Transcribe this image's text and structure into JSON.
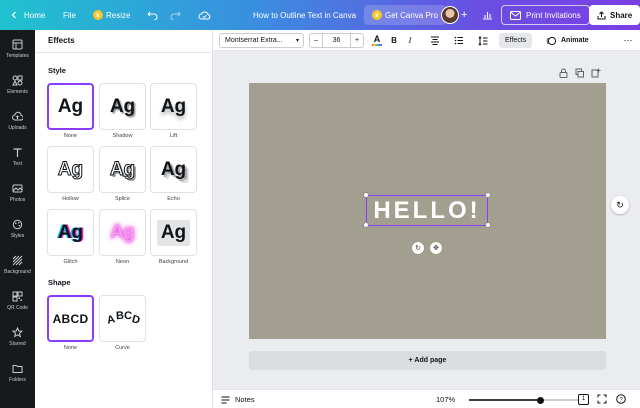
{
  "topbar": {
    "home": "Home",
    "file": "File",
    "resize": "Resize",
    "doc_title": "How to Outline Text in Canva",
    "get_pro": "Get Canva Pro",
    "print": "Print Invitations",
    "share": "Share"
  },
  "rail": {
    "items": [
      {
        "label": "Templates",
        "icon": "templates-icon"
      },
      {
        "label": "Elements",
        "icon": "elements-icon"
      },
      {
        "label": "Uploads",
        "icon": "uploads-icon"
      },
      {
        "label": "Text",
        "icon": "text-icon"
      },
      {
        "label": "Photos",
        "icon": "photos-icon"
      },
      {
        "label": "Styles",
        "icon": "styles-icon"
      },
      {
        "label": "Background",
        "icon": "background-icon"
      },
      {
        "label": "QR Code",
        "icon": "qr-code-icon"
      },
      {
        "label": "Starred",
        "icon": "star-icon"
      },
      {
        "label": "Folders",
        "icon": "folder-icon"
      }
    ]
  },
  "panel": {
    "title": "Effects",
    "style_heading": "Style",
    "shape_heading": "Shape",
    "sample": "Ag",
    "shape_sample": "ABCD",
    "styles": [
      {
        "label": "None",
        "selected": true
      },
      {
        "label": "Shadow",
        "selected": false
      },
      {
        "label": "Lift",
        "selected": false
      },
      {
        "label": "Hollow",
        "selected": false
      },
      {
        "label": "Splice",
        "selected": false
      },
      {
        "label": "Echo",
        "selected": false
      },
      {
        "label": "Glitch",
        "selected": false
      },
      {
        "label": "Neon",
        "selected": false
      },
      {
        "label": "Background",
        "selected": false
      }
    ],
    "shapes": [
      {
        "label": "None",
        "selected": true
      },
      {
        "label": "Curve",
        "selected": false
      }
    ]
  },
  "toolbar": {
    "font": "Montserrat Extra...",
    "size": "36",
    "minus": "–",
    "plus": "+",
    "bold": "B",
    "italic": "I",
    "effects": "Effects",
    "animate": "Animate"
  },
  "canvas": {
    "text": "HELLO!",
    "add_page": "+ Add page",
    "page_color": "#a39f90"
  },
  "bottombar": {
    "notes": "Notes",
    "zoom": "107%",
    "zoom_level": 0.65,
    "page_count": "1"
  },
  "colors": {
    "accent": "#8b3dff",
    "rail": "#18191b"
  }
}
